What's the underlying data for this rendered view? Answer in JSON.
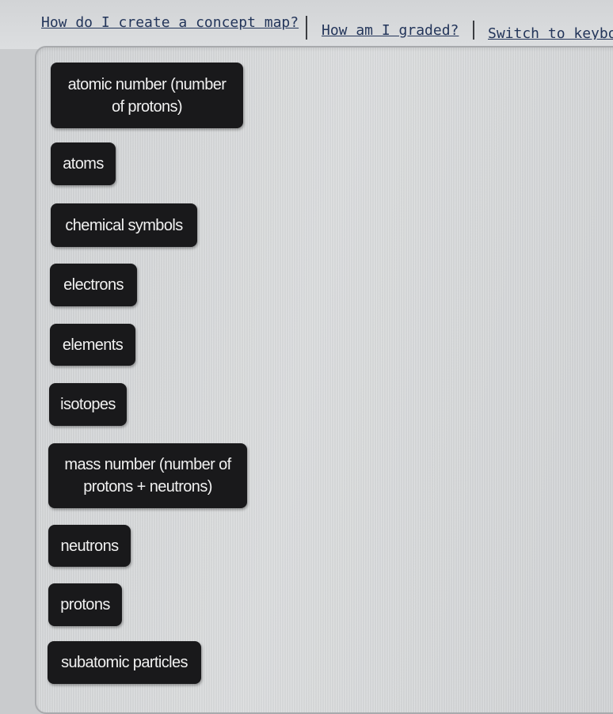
{
  "help_links": {
    "concept_map": "How do I create a concept map?",
    "graded": "How am I graded?",
    "keyboard": "Switch to keyboa"
  },
  "concept_tiles": [
    {
      "label": "atomic number (number of protons)"
    },
    {
      "label": "atoms"
    },
    {
      "label": "chemical symbols"
    },
    {
      "label": "electrons"
    },
    {
      "label": "elements"
    },
    {
      "label": "isotopes"
    },
    {
      "label": "mass number (number of protons + neutrons)"
    },
    {
      "label": "neutrons"
    },
    {
      "label": "protons"
    },
    {
      "label": "subatomic particles"
    }
  ]
}
